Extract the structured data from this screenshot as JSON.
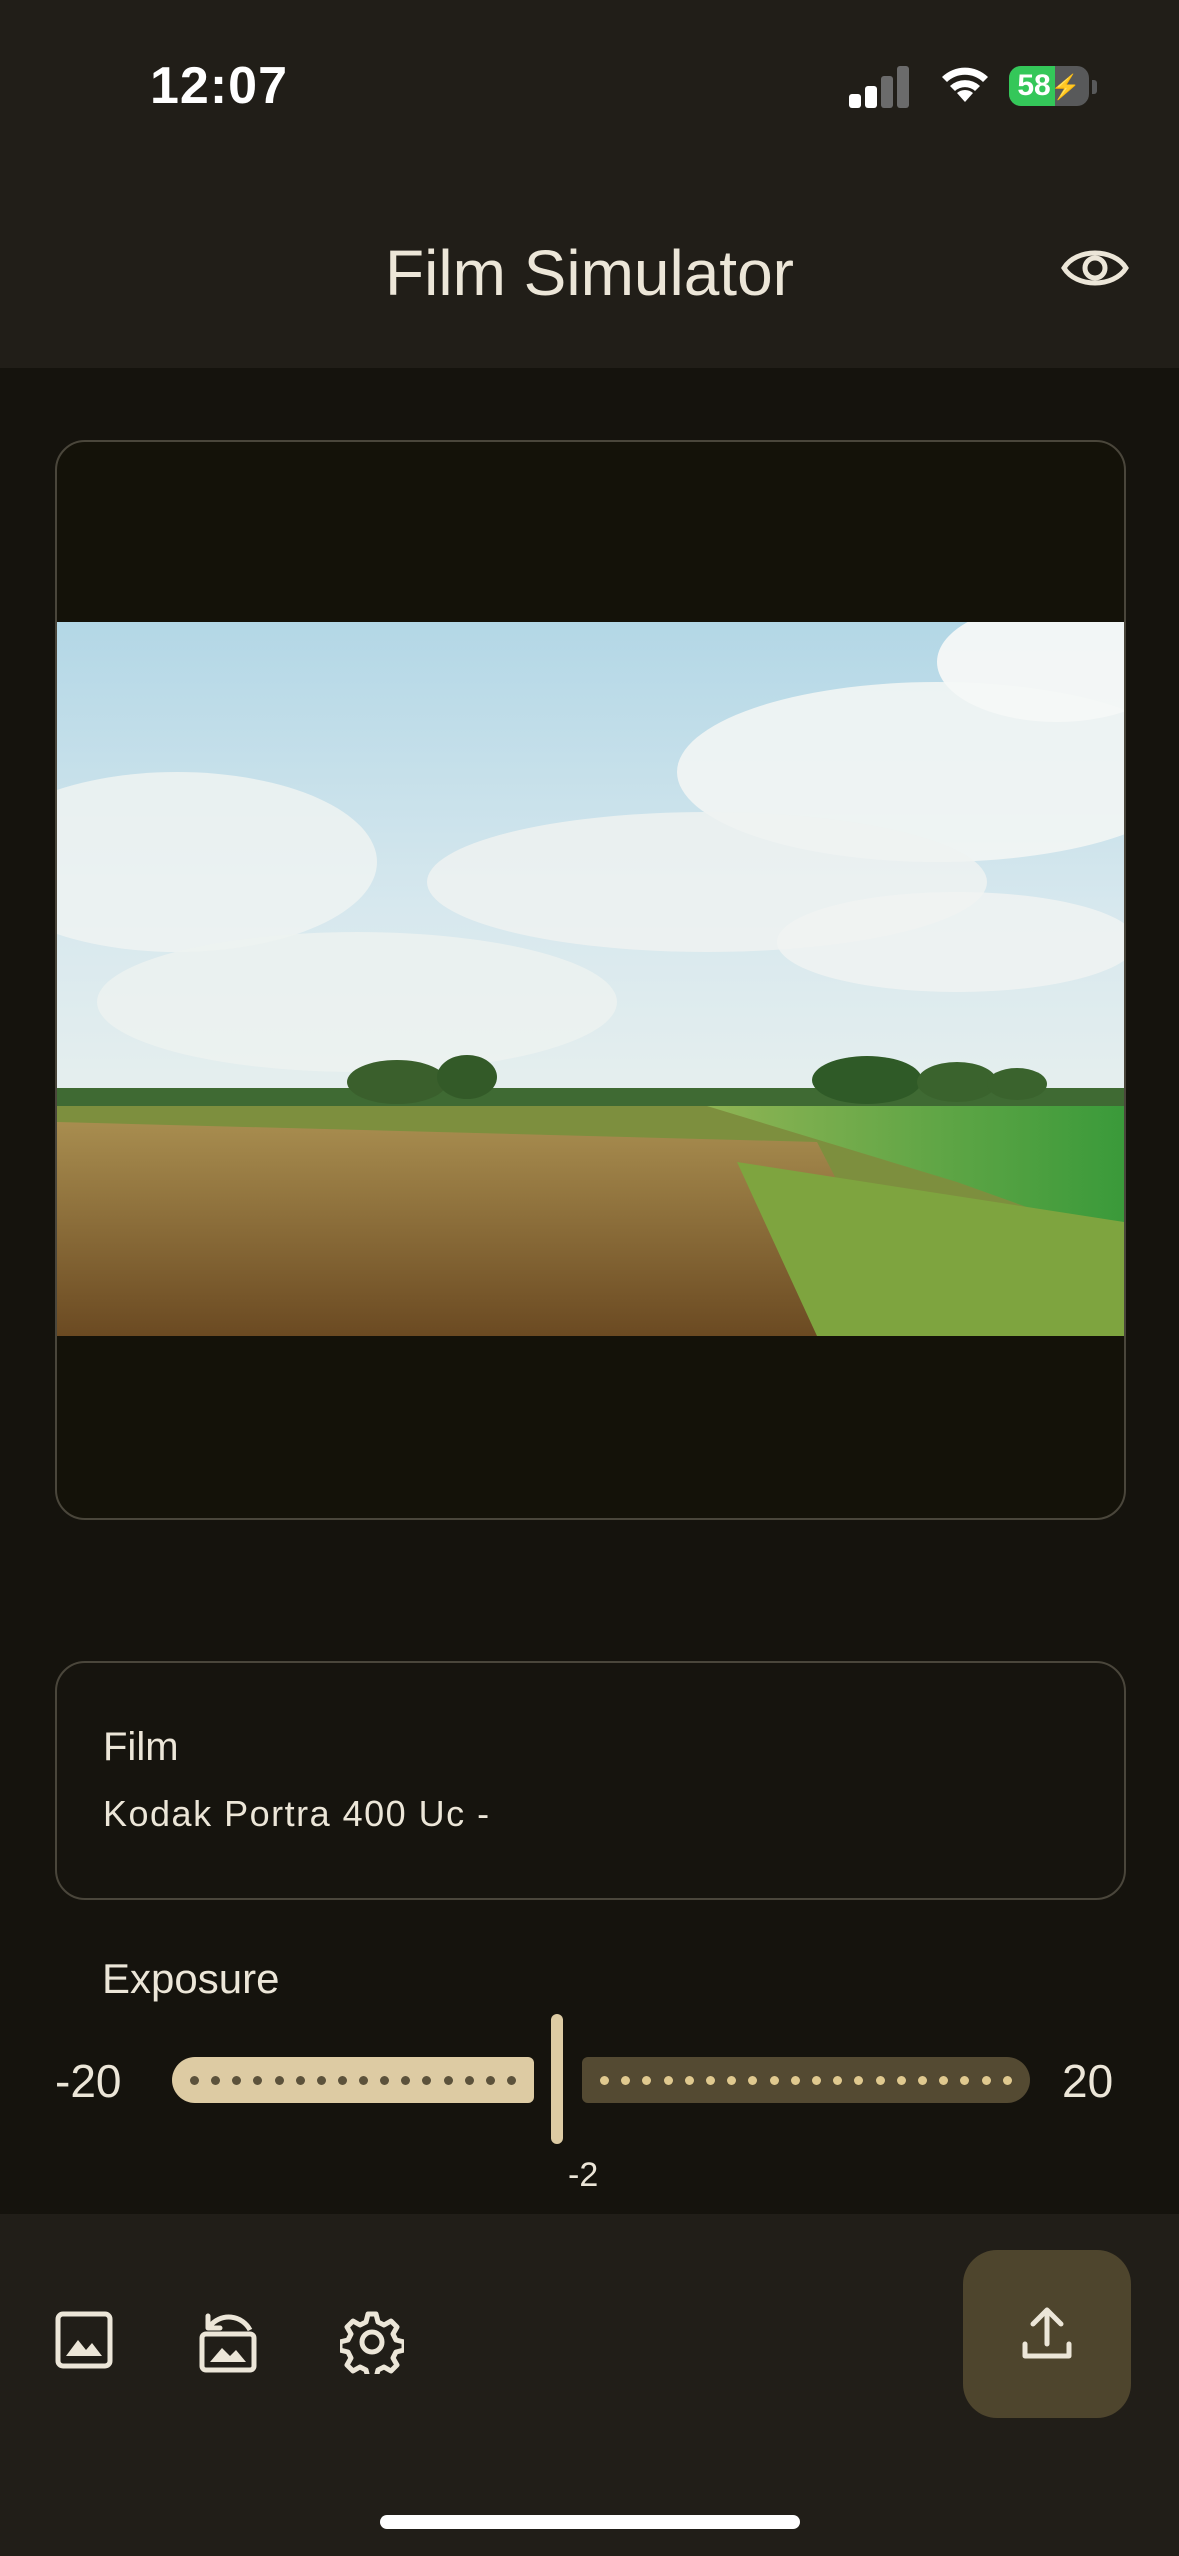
{
  "status_bar": {
    "time": "12:07",
    "battery": "58",
    "battery_level": 0.58,
    "charging": true
  },
  "app_bar": {
    "title": "Film Simulator",
    "preview_icon": "eye-icon"
  },
  "photo": {
    "description_icon": "photo-preview"
  },
  "film": {
    "label": "Film",
    "value": "Kodak Portra 400 Uc -"
  },
  "exposure": {
    "label": "Exposure",
    "min": "-20",
    "max": "20",
    "value": "-2",
    "value_num": -2,
    "range": [
      -20,
      20
    ]
  },
  "toolbar": {
    "items": [
      {
        "name": "gallery-icon"
      },
      {
        "name": "restore-image-icon"
      },
      {
        "name": "settings-icon"
      }
    ],
    "share_icon": "upload-icon"
  },
  "colors": {
    "background": "#15130d",
    "bar": "#211e18",
    "accent": "#ddcba3",
    "accent_dark": "#4e452d"
  }
}
